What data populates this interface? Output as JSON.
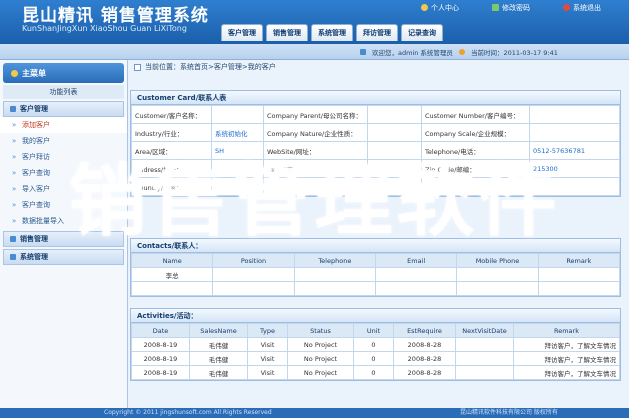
{
  "header": {
    "logo_cn": "昆山精讯 销售管理系统",
    "logo_en": "KunShanJingXun XiaoShou Guan LiXiTong",
    "links": [
      {
        "label": "个人中心",
        "icon": "user-icon"
      },
      {
        "label": "修改密码",
        "icon": "key-icon"
      },
      {
        "label": "系统退出",
        "icon": "exit-icon"
      }
    ],
    "nav": [
      "客户管理",
      "销售管理",
      "系统管理",
      "拜访管理",
      "记录查询"
    ]
  },
  "subbar": {
    "welcome": "欢迎您，admin 系统管理员",
    "time": "当前时间：2011-03-17 9:41"
  },
  "sidebar": {
    "title": "主菜单",
    "func": "功能列表",
    "groups": {
      "customer": "客户管理",
      "sales": "销售管理",
      "system": "系统管理"
    },
    "items": [
      "添加客户",
      "我的客户",
      "客户拜访",
      "客户查询",
      "导入客户",
      "客户查询",
      "数据批量导入"
    ]
  },
  "breadcrumb": "当前位置：系统首页>客户管理>我的客户",
  "customer_card": {
    "title": "Customer Card/联系人表",
    "rows": [
      [
        "Customer/客户名称：",
        "",
        "Company Parent/母公司名称：",
        "",
        "Customer Number/客户编号：",
        ""
      ],
      [
        "Industry/行业：",
        "系统初始化",
        "Company Nature/企业性质：",
        "",
        "Company Scale/企业规模：",
        ""
      ],
      [
        "Area/区域：",
        "SH",
        "WebSite/网址：",
        "",
        "Telephone/电话：",
        "0512-57636781"
      ],
      [
        "Address/地址：",
        "",
        "Fax/传真：",
        "",
        "Zip Code/邮编：",
        "215300"
      ],
      [
        "Country/国家：",
        "",
        "",
        "",
        "",
        ""
      ]
    ]
  },
  "contacts": {
    "title": "Contacts/联系人：",
    "headers": [
      "Name",
      "Position",
      "Telephone",
      "Email",
      "Mobile Phone",
      "Remark"
    ],
    "rows": [
      [
        "李总",
        "",
        "",
        "",
        "",
        ""
      ]
    ]
  },
  "activities": {
    "title": "Activities/活动：",
    "headers": [
      "Date",
      "SalesName",
      "Type",
      "Status",
      "Unit",
      "EstRequire",
      "NextVisitDate",
      "Remark"
    ],
    "rows": [
      [
        "2008-8-19",
        "毛伟健",
        "Visit",
        "No Project",
        "0",
        "2008-8-28",
        "",
        "拜访客户，了解文车情况"
      ],
      [
        "2008-8-19",
        "毛伟健",
        "Visit",
        "No Project",
        "0",
        "2008-8-28",
        "",
        "拜访客户，了解文车情况"
      ],
      [
        "2008-8-19",
        "毛伟健",
        "Visit",
        "No Project",
        "0",
        "2008-8-28",
        "",
        "拜访客户，了解文车情况"
      ]
    ]
  },
  "footer": {
    "left": "Copyright © 2011 jingshunsoft.com All Rights Reserved",
    "right": "昆山精讯软件科技有限公司 版权所有"
  },
  "watermark": "销售管理软件"
}
